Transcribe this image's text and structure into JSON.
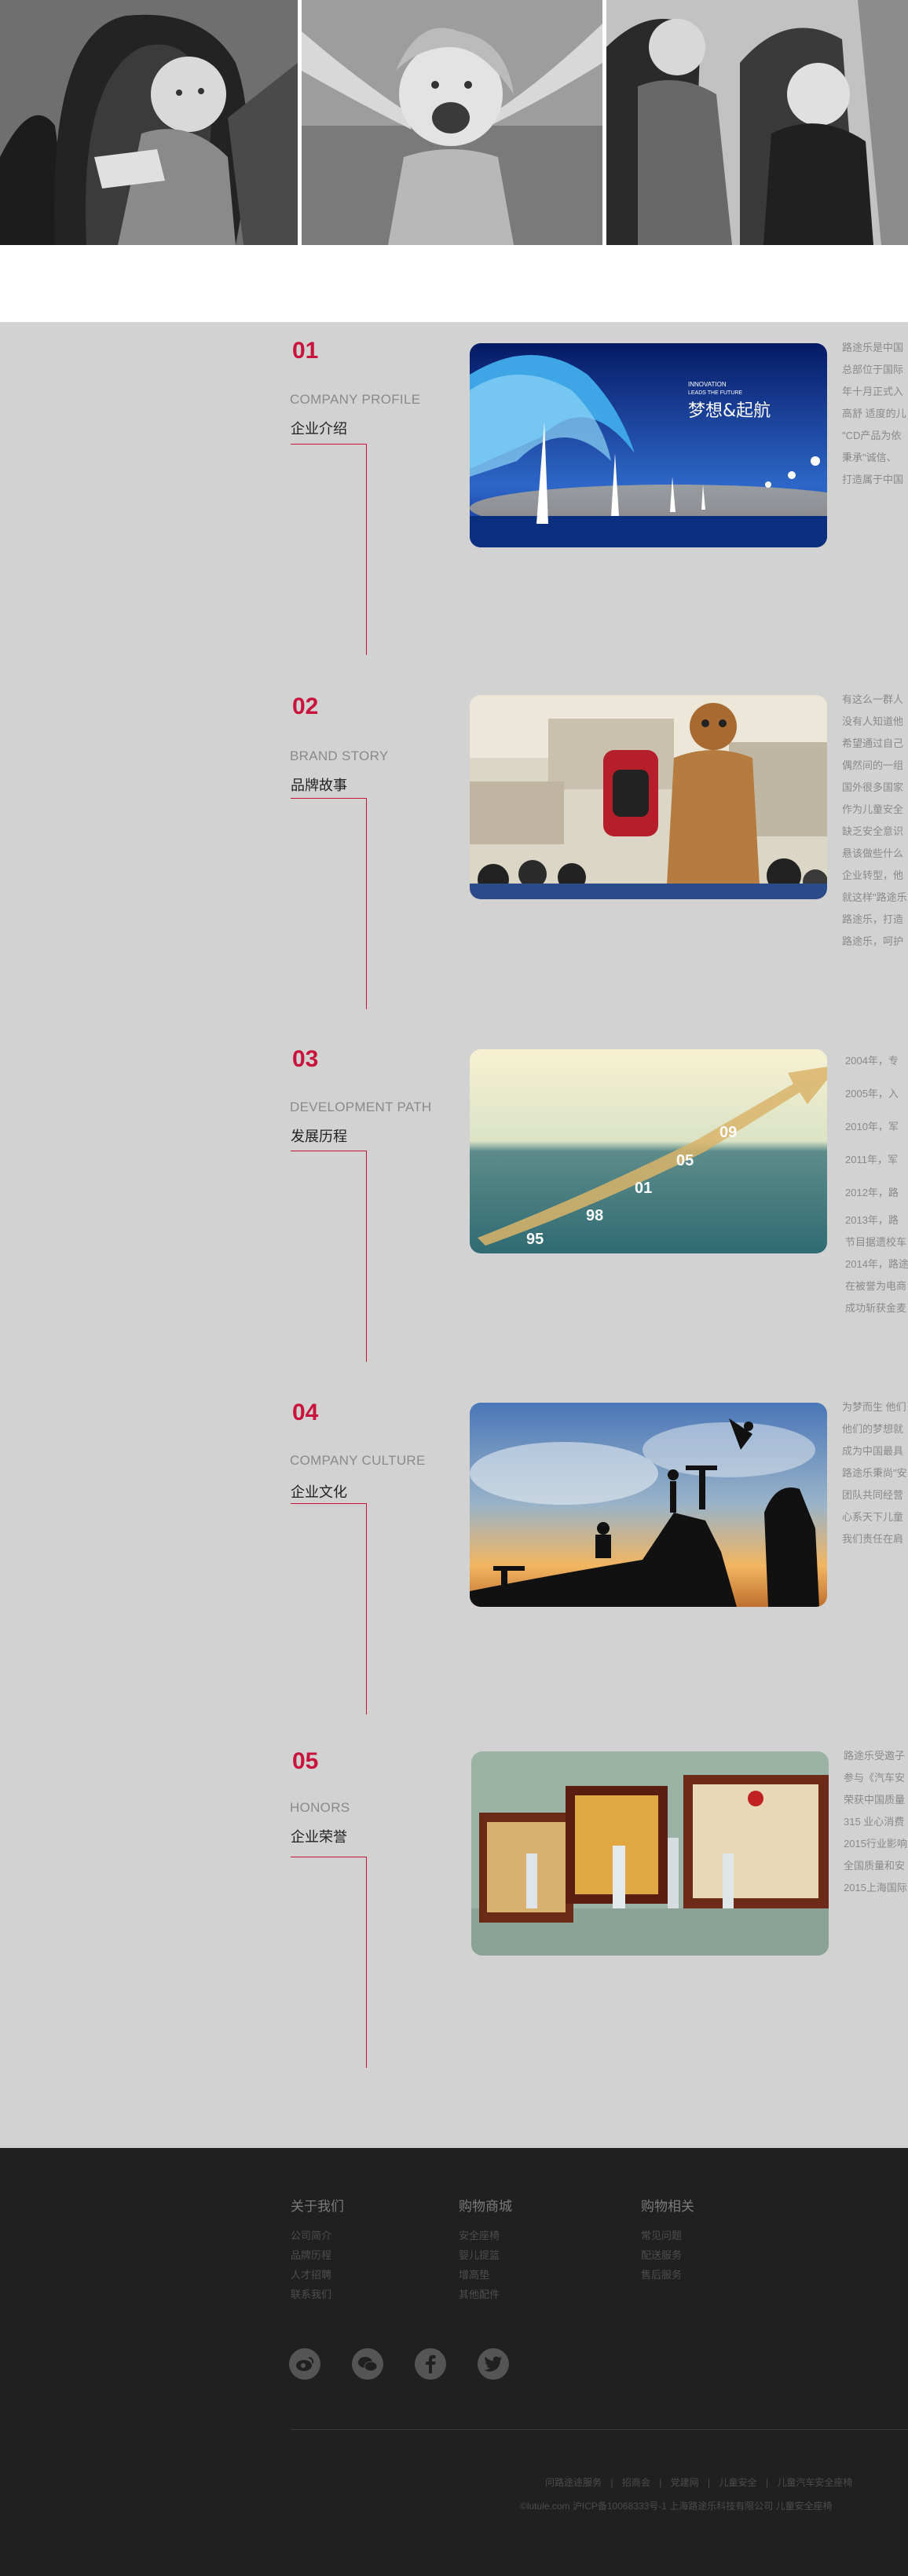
{
  "hero": {
    "images": [
      "child-in-car-seat-photo",
      "laughing-girl-photo",
      "two-children-in-car-seats-photo"
    ]
  },
  "sections": [
    {
      "num": "01",
      "en": "COMPANY PROFILE",
      "cn": "企业介绍",
      "image_caption_title": "梦想&起航",
      "image_caption_small": "INNOVATION\nLEADS THE FUTURE",
      "text": [
        "路途乐是中国",
        "总部位于国际",
        "年十月正式入",
        "高舒 适度的儿",
        "\"CD产品为依",
        "秉承\"诚信、",
        "打造属于中国"
      ]
    },
    {
      "num": "02",
      "en": "BRAND STORY",
      "cn": "品牌故事",
      "text": [
        "有这么一群人",
        "没有人知道他",
        "希望通过自己",
        "偶然间的一组",
        "国外很多国家",
        "作为儿童安全",
        "缺乏安全意识",
        "悬该做些什么",
        "企业转型，他",
        "就这样\"路途乐",
        "路途乐，打造",
        "路途乐，呵护"
      ]
    },
    {
      "num": "03",
      "en": "DEVELOPMENT PATH",
      "cn": "发展历程",
      "image_labels": [
        "95",
        "98",
        "01",
        "05",
        "09"
      ],
      "text": [
        "2004年，专",
        "2005年，入",
        "2010年，军",
        "2011年，军",
        "2012年，路",
        "2013年，路",
        "节目据遗校车",
        "2014年，路途",
        "在被誉为电商",
        "成功斩获金麦"
      ]
    },
    {
      "num": "04",
      "en": "COMPANY CULTURE",
      "cn": "企业文化",
      "text": [
        "为梦而生 他们",
        "他们的梦想就",
        "成为中国最具",
        "路途乐秉尚\"安",
        "团队共同经营",
        "心系天下儿童",
        "我们责任在肩"
      ]
    },
    {
      "num": "05",
      "en": "HONORS",
      "cn": "企业荣誉",
      "text": [
        "路途乐受邀子",
        "参与《汽车安",
        "荣获中国质量",
        "315 业心消费",
        "2015行业影响",
        "全国质量和安",
        "2015上海国际"
      ]
    }
  ],
  "footer": {
    "columns": [
      {
        "title": "关于我们",
        "items": [
          "公司简介",
          "品牌历程",
          "人才招聘",
          "联系我们"
        ]
      },
      {
        "title": "购物商城",
        "items": [
          "安全座椅",
          "婴儿提篮",
          "增高垫",
          "其他配件"
        ]
      },
      {
        "title": "购物相关",
        "items": [
          "常见问题",
          "配送服务",
          "售后服务"
        ]
      }
    ],
    "social": [
      "weibo-icon",
      "wechat-icon",
      "facebook-icon",
      "twitter-icon"
    ],
    "links": [
      "问路途途服务",
      "|",
      "招商会",
      "|",
      "党建网",
      "|",
      "儿童安全",
      "|",
      "儿童汽车安全座椅"
    ],
    "copyright": "©lutule.com 沪ICP备10068333号-1 上海路途乐科技有限公司 儿童安全座椅"
  }
}
